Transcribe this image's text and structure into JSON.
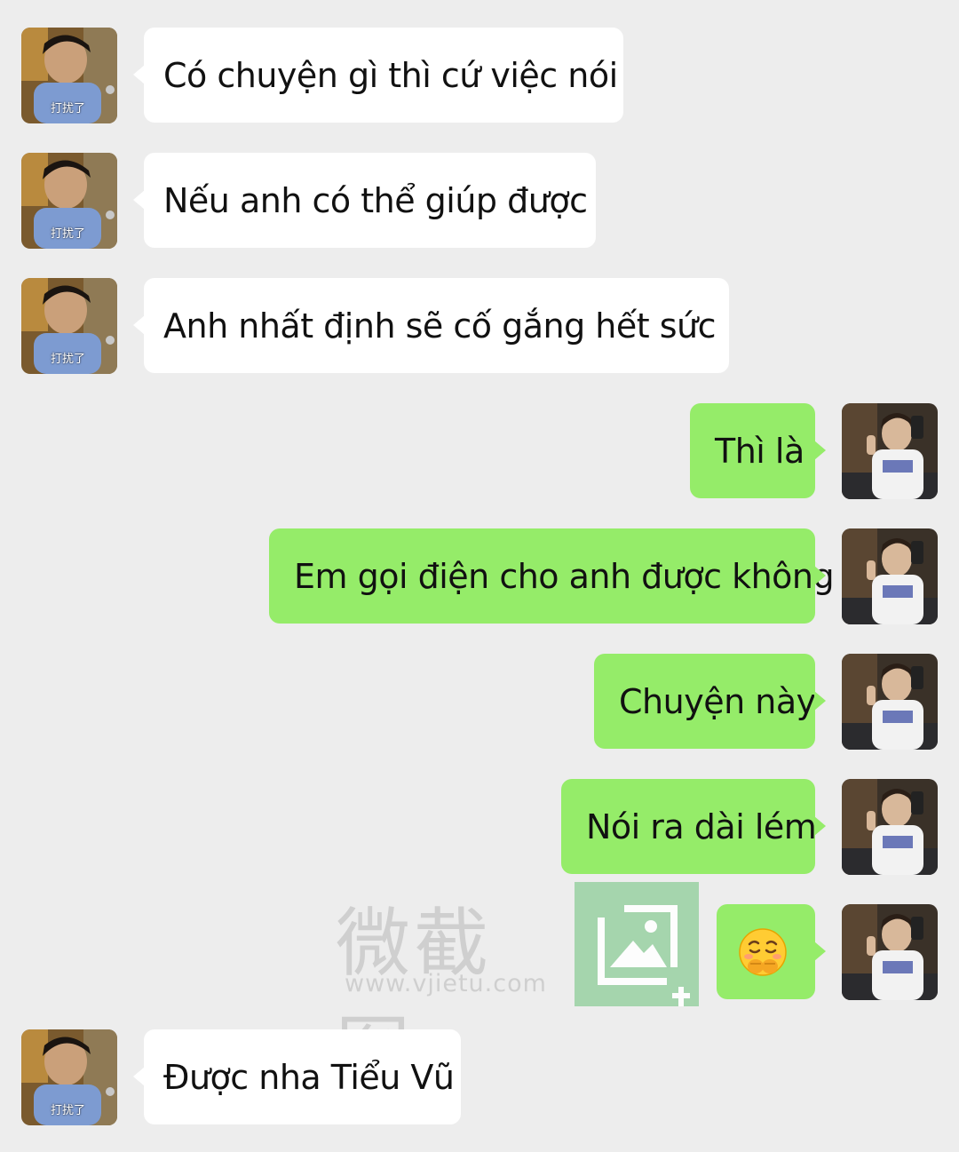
{
  "theme": {
    "background": "#ededed",
    "incoming_bubble": "#ffffff",
    "outgoing_bubble": "#95ec69"
  },
  "contact_avatar": {
    "icon": "boy-avatar-icon",
    "caption": "打扰了"
  },
  "self_avatar": {
    "icon": "mirror-selfie-avatar-icon"
  },
  "messages": [
    {
      "sender": "contact",
      "text": "Có chuyện gì thì cứ việc nói"
    },
    {
      "sender": "contact",
      "text": "Nếu anh có thể giúp được"
    },
    {
      "sender": "contact",
      "text": "Anh nhất định sẽ cố gắng hết sức"
    },
    {
      "sender": "self",
      "text": "Thì là"
    },
    {
      "sender": "self",
      "text": "Em gọi điện cho anh được không"
    },
    {
      "sender": "self",
      "text": "Chuyện này"
    },
    {
      "sender": "self",
      "text": "Nói ra dài lém"
    },
    {
      "sender": "self",
      "emoji": "pleading-hands-over-mouth-emoji"
    },
    {
      "sender": "contact",
      "text": "Được nha Tiểu Vũ"
    }
  ],
  "watermark": {
    "title": "微截图",
    "url": "www.vjietu.com",
    "icon": "picture-frame-icon"
  }
}
